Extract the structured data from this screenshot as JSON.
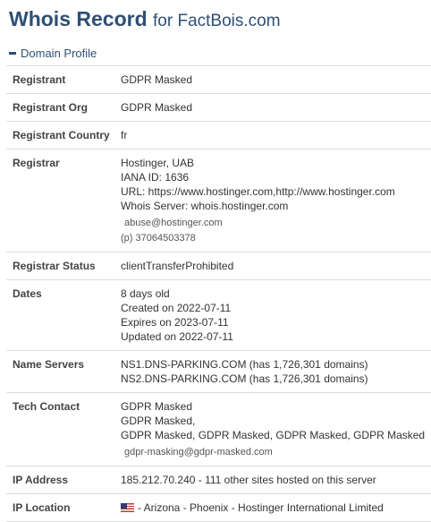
{
  "header": {
    "title": "Whois Record",
    "subtitle": "for FactBois.com"
  },
  "section": {
    "label": "Domain Profile"
  },
  "rows": {
    "registrant": {
      "label": "Registrant",
      "value": "GDPR Masked"
    },
    "registrant_org": {
      "label": "Registrant Org",
      "value": "GDPR Masked"
    },
    "registrant_country": {
      "label": "Registrant Country",
      "value": "fr"
    },
    "registrar": {
      "label": "Registrar",
      "name": "Hostinger, UAB",
      "iana": "IANA ID: 1636",
      "url": "URL: https://www.hostinger.com,http://www.hostinger.com",
      "whois_server": "Whois Server: whois.hostinger.com",
      "email": "abuse@hostinger.com",
      "phone": "(p)  37064503378"
    },
    "registrar_status": {
      "label": "Registrar Status",
      "value": "clientTransferProhibited"
    },
    "dates": {
      "label": "Dates",
      "age": "8 days old",
      "created": "Created on 2022-07-11",
      "expires": "Expires on 2023-07-11",
      "updated": "Updated on 2022-07-11"
    },
    "name_servers": {
      "label": "Name Servers",
      "ns1": "NS1.DNS-PARKING.COM (has 1,726,301 domains)",
      "ns2": "NS2.DNS-PARKING.COM (has 1,726,301 domains)"
    },
    "tech_contact": {
      "label": "Tech Contact",
      "line1": "GDPR Masked",
      "line2": "GDPR Masked,",
      "line3": "GDPR Masked, GDPR Masked, GDPR Masked, GDPR Masked",
      "email": "gdpr-masking@gdpr-masked.com"
    },
    "ip_address": {
      "label": "IP Address",
      "value": "185.212.70.240 - 111 other sites hosted on this server"
    },
    "ip_location": {
      "label": "IP Location",
      "value": "- Arizona - Phoenix - Hostinger International Limited",
      "flag_icon": "us-flag-icon"
    }
  }
}
